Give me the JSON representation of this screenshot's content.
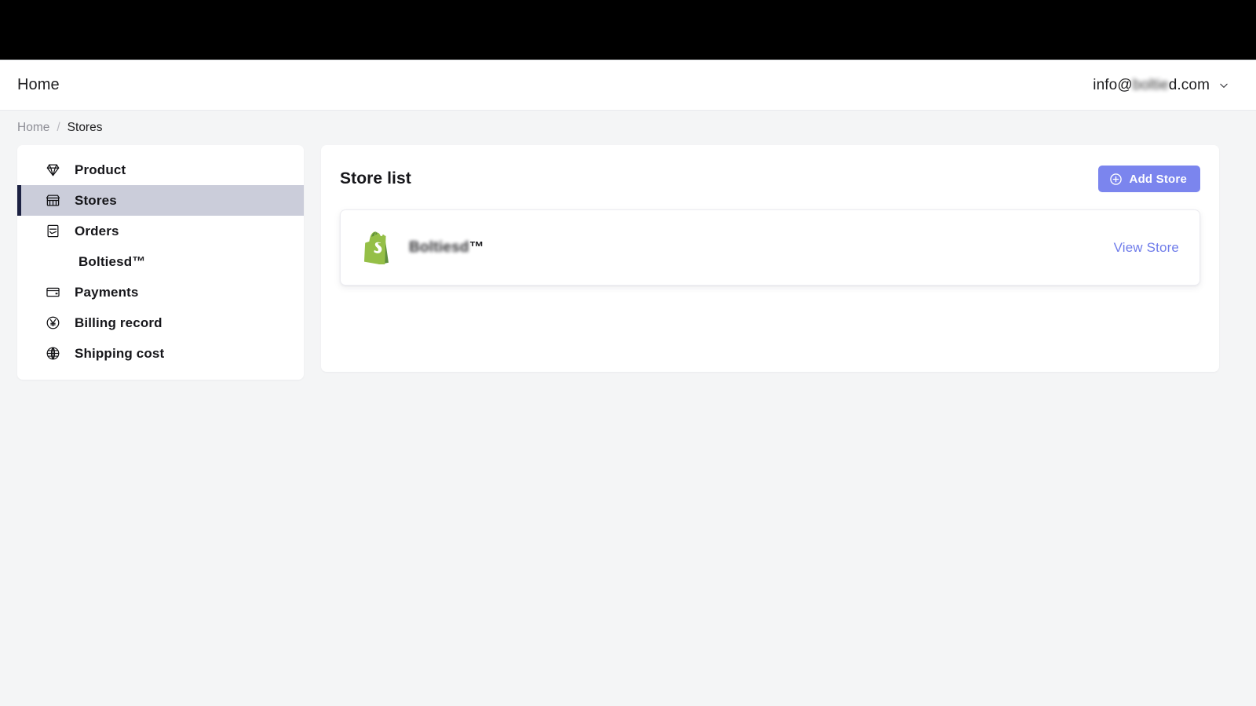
{
  "window": {
    "top_bar_color": "#000000"
  },
  "header": {
    "title": "Home",
    "account": {
      "email_prefix": "info@",
      "email_redacted": "boltie",
      "email_suffix": "d.com",
      "chevron_icon": "chevron-down-icon"
    }
  },
  "breadcrumb": {
    "home": "Home",
    "separator": "/",
    "current": "Stores"
  },
  "sidebar": {
    "items": [
      {
        "label": "Product",
        "icon": "diamond-icon",
        "active": false
      },
      {
        "label": "Stores",
        "icon": "storefront-icon",
        "active": true
      },
      {
        "label": "Orders",
        "icon": "order-receipt-icon",
        "active": false
      },
      {
        "label": "Boltiesd™",
        "icon": "",
        "active": false,
        "sub": true
      },
      {
        "label": "Payments",
        "icon": "credit-card-icon",
        "active": false
      },
      {
        "label": "Billing record",
        "icon": "yen-circle-icon",
        "active": false
      },
      {
        "label": "Shipping cost",
        "icon": "globe-icon",
        "active": false
      }
    ],
    "active_bg": "#cbcdda",
    "active_accent": "#1c2142"
  },
  "main": {
    "title": "Store list",
    "add_store_label": "Add Store",
    "add_store_icon": "plus-circle-icon",
    "accent_color": "#7b85ee",
    "stores": [
      {
        "logo_icon": "shopify-logo-icon",
        "name_redacted": "Boltiesd",
        "name_suffix": "™",
        "action_label": "View Store"
      }
    ]
  }
}
